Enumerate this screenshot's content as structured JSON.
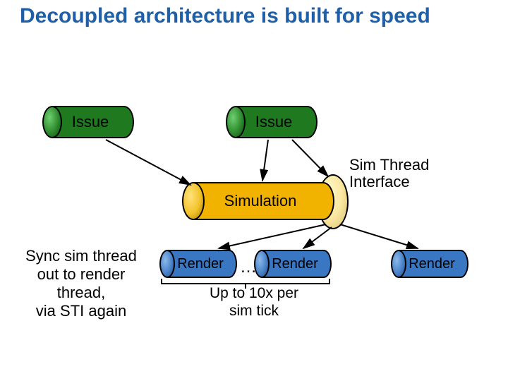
{
  "title": "Decoupled architecture is built for speed",
  "issue1": "Issue",
  "issue2": "Issue",
  "simulation": "Simulation",
  "sti_label_line1": "Sim Thread",
  "sti_label_line2": "Interface",
  "render1": "Render",
  "render2": "Render",
  "render3": "Render",
  "ellipsis": "…",
  "upto_line1": "Up to 10x per",
  "upto_line2": "sim tick",
  "sync_line1": "Sync sim thread",
  "sync_line2": "out to render",
  "sync_line3": "thread,",
  "sync_line4": "via STI again",
  "chart_data": {
    "type": "diagram",
    "nodes": [
      {
        "id": "issue1",
        "label": "Issue",
        "kind": "cylinder",
        "color": "green"
      },
      {
        "id": "issue2",
        "label": "Issue",
        "kind": "cylinder",
        "color": "green"
      },
      {
        "id": "simulation",
        "label": "Simulation",
        "kind": "cylinder",
        "color": "yellow"
      },
      {
        "id": "sti",
        "label": "Sim Thread Interface",
        "kind": "disc",
        "color": "cream"
      },
      {
        "id": "render1",
        "label": "Render",
        "kind": "cylinder",
        "color": "blue"
      },
      {
        "id": "render2",
        "label": "Render",
        "kind": "cylinder",
        "color": "blue"
      },
      {
        "id": "render3",
        "label": "Render",
        "kind": "cylinder",
        "color": "blue"
      }
    ],
    "edges": [
      {
        "from": "issue1",
        "to": "simulation"
      },
      {
        "from": "issue2",
        "to": "simulation"
      },
      {
        "from": "issue2",
        "to": "sti"
      },
      {
        "from": "simulation",
        "to": "render1",
        "via": "sti"
      },
      {
        "from": "simulation",
        "to": "render2",
        "via": "sti"
      },
      {
        "from": "simulation",
        "to": "render3",
        "via": "sti"
      }
    ],
    "annotations": [
      {
        "text": "Up to 10x per sim tick",
        "applies_to": [
          "render1",
          "render2"
        ]
      },
      {
        "text": "Sync sim thread out to render thread, via STI again",
        "applies_to": [
          "render1",
          "render2",
          "render3"
        ]
      }
    ]
  }
}
